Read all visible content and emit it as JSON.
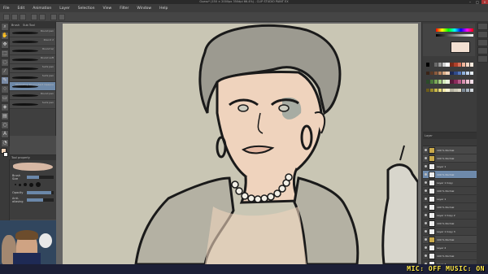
{
  "window": {
    "title": "Guess* (150 × 2000px 350dpi 66.4%) - CLIP STUDIO PAINT EX"
  },
  "menu": [
    "File",
    "Edit",
    "Animation",
    "Layer",
    "Selection",
    "View",
    "Filter",
    "Window",
    "Help"
  ],
  "brush_panel": {
    "tabs": [
      "Brush",
      "Sub Tool"
    ],
    "items": [
      {
        "name": "Round pen"
      },
      {
        "name": "Round 2"
      },
      {
        "name": "Round w/"
      },
      {
        "name": "Round soft"
      },
      {
        "name": "Sumi pen"
      },
      {
        "name": "Sumi pen"
      },
      {
        "name": "Photoshop Round Hard Opaque",
        "selected": true
      },
      {
        "name": "Round pen"
      },
      {
        "name": "Sumi pen"
      }
    ]
  },
  "tool_property": {
    "header": "Tool property",
    "rows": [
      {
        "label": "Brush Size",
        "fill": 0.45
      },
      {
        "label": "Opacity",
        "fill": 0.9
      },
      {
        "label": "Anti-aliasing",
        "fill": 0.6
      }
    ],
    "colors": {
      "foreground": "#f0d2b8",
      "background": "#ffffff"
    }
  },
  "color_panel": {
    "current": "#f3e0d2"
  },
  "palette": [
    "#000000",
    "#3a3a3a",
    "#6a6a6a",
    "#9a9a9a",
    "#cfcfcf",
    "#ffffff",
    "#7a2b1a",
    "#b0402a",
    "#d8735a",
    "#f1b59a",
    "#f6d7c4",
    "#fbeadd",
    "#3a2418",
    "#5c3a26",
    "#8b5a3c",
    "#b5825d",
    "#d9ac87",
    "#f0d2b8",
    "#1e2a55",
    "#2f4a8a",
    "#5577bb",
    "#8fb1dd",
    "#c3d6ee",
    "#e6eef8",
    "#2b4a2a",
    "#4b7a3a",
    "#79a856",
    "#a8cf82",
    "#d1e8b8",
    "#eaf4dd",
    "#5a1a3a",
    "#8a2a5a",
    "#b85a8a",
    "#d890b0",
    "#efc1d4",
    "#f8e1ea",
    "#6a5a1a",
    "#9a8a2a",
    "#c8b84a",
    "#e4d878",
    "#f2eaa8",
    "#faf5d6",
    "#b3b0a0",
    "#c9c6b4",
    "#dcd8c6",
    "#7e8a96",
    "#a6b2be",
    "#d2d8de"
  ],
  "layer_panel": {
    "header": "Layer",
    "rows": [
      {
        "name": "100 % Normal",
        "type": "folder"
      },
      {
        "name": "100 % Normal",
        "type": "folder"
      },
      {
        "name": "Layer 1",
        "type": "layer"
      },
      {
        "name": "100 % Normal",
        "type": "layer",
        "selected": true
      },
      {
        "name": "Layer 1 Copy",
        "type": "layer"
      },
      {
        "name": "100 % Normal",
        "type": "layer"
      },
      {
        "name": "Layer 1",
        "type": "layer"
      },
      {
        "name": "100 % Normal",
        "type": "layer"
      },
      {
        "name": "Layer 1 Copy 2",
        "type": "layer"
      },
      {
        "name": "100 % Normal",
        "type": "layer"
      },
      {
        "name": "Layer 1 Copy 3",
        "type": "layer"
      },
      {
        "name": "100 % Normal",
        "type": "folder"
      },
      {
        "name": "Layer 2",
        "type": "layer"
      },
      {
        "name": "100 % Normal",
        "type": "layer"
      },
      {
        "name": "Layer 3",
        "type": "layer"
      }
    ]
  },
  "overlay": {
    "text": "MIC: OFF MUSIC: ON"
  }
}
